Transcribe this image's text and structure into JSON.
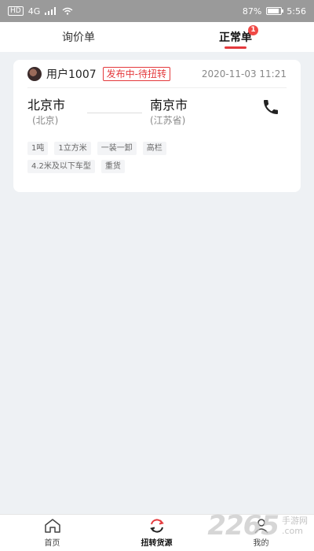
{
  "status_bar": {
    "network_chip": "HD",
    "signal": "4G",
    "battery_text": "87%",
    "battery_level": 0.87,
    "time": "5:56"
  },
  "tabs": [
    {
      "label": "询价单",
      "active": false
    },
    {
      "label": "正常单",
      "active": true,
      "badge": "1"
    }
  ],
  "order": {
    "user": "用户1007",
    "status": "发布中-待扭转",
    "time": "2020-11-03 11:21",
    "origin_city": "北京市",
    "origin_province": "(北京)",
    "dest_city": "南京市",
    "dest_province": "(江苏省)",
    "tags": [
      "1吨",
      "1立方米",
      "一装一卸",
      "高栏",
      "4.2米及以下车型",
      "重货"
    ]
  },
  "bottom_nav": [
    {
      "label": "首页",
      "icon": "home-icon"
    },
    {
      "label": "扭转货源",
      "icon": "refresh-icon"
    },
    {
      "label": "我的",
      "icon": "user-icon"
    }
  ],
  "watermark": {
    "number": "2265",
    "line1": "手游网",
    "line2": ".com"
  },
  "colors": {
    "accent": "#e4393c",
    "badge": "#f04a46",
    "background": "#eef1f4"
  }
}
